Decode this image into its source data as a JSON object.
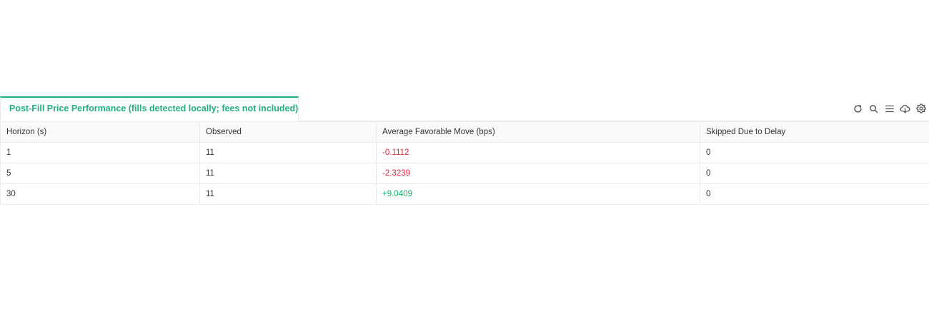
{
  "panel": {
    "tab_label": "Post-Fill Price Performance (fills detected locally; fees not included)",
    "toolbar": {
      "icons": [
        "refresh-icon",
        "search-icon",
        "list-icon",
        "cloud-download-icon",
        "gear-icon"
      ]
    }
  },
  "table": {
    "columns": [
      "Horizon (s)",
      "Observed",
      "Average Favorable Move (bps)",
      "Skipped Due to Delay"
    ],
    "rows": [
      {
        "horizon": "1",
        "observed": "11",
        "avg_move": "-0.1112",
        "skipped": "0"
      },
      {
        "horizon": "5",
        "observed": "11",
        "avg_move": "-2.3239",
        "skipped": "0"
      },
      {
        "horizon": "30",
        "observed": "11",
        "avg_move": "+9.0409",
        "skipped": "0"
      }
    ]
  },
  "colors": {
    "accent": "#21b07c",
    "negative": "#e0243e",
    "positive": "#19b46e"
  }
}
